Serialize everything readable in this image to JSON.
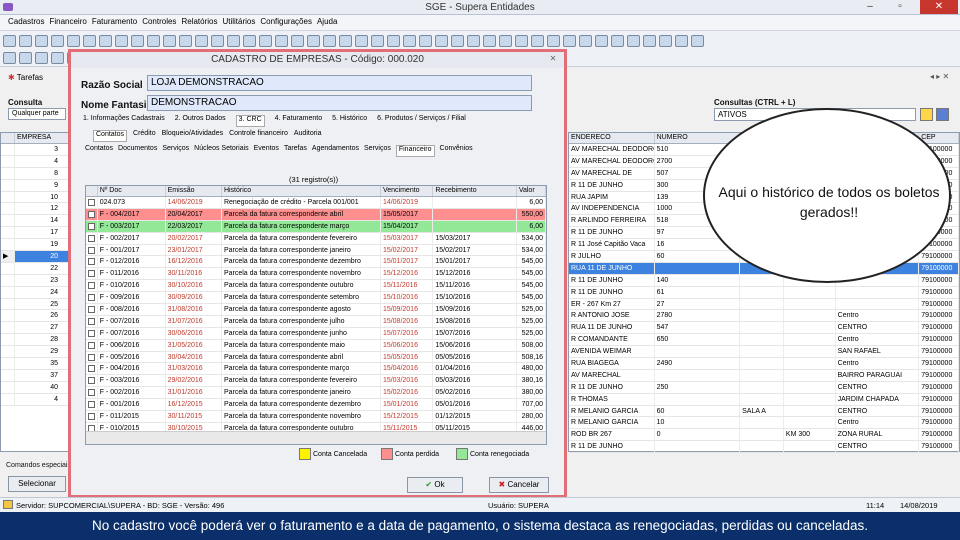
{
  "window": {
    "title": "SGE - Supera Entidades"
  },
  "menu": [
    "Cadastros",
    "Financeiro",
    "Faturamento",
    "Controles",
    "Relatórios",
    "Utilitários",
    "Configurações",
    "Ajuda"
  ],
  "tabs": {
    "tarefas": "Tarefas"
  },
  "left_panel": {
    "consulta_label": "Consulta",
    "consulta_value": "Qualquer parte",
    "col_empresa": "EMPRESA",
    "rows": [
      "3",
      "4",
      "8",
      "9",
      "10",
      "12",
      "14",
      "17",
      "19",
      "20",
      "22",
      "23",
      "24",
      "25",
      "26",
      "27",
      "28",
      "29",
      "35",
      "37",
      "40",
      "4"
    ],
    "bottom_label": "Comandos especiais",
    "bottom_btn": "Selecionar"
  },
  "right_panel": {
    "consultas_label": "Consultas (CTRL + L)",
    "consultas_value": "ATIVOS",
    "headers": [
      "ENDERECO",
      "NUMERO",
      "",
      "",
      "",
      "CEP"
    ],
    "rows": [
      [
        "AV MARECHAL DEODORO",
        "510",
        "",
        "",
        "",
        "79100000"
      ],
      [
        "AV MARECHAL DEODORO",
        "2700",
        "",
        "",
        "",
        "79100000"
      ],
      [
        "AV MARECHAL DE",
        "507",
        "",
        "",
        "",
        "79100000"
      ],
      [
        "R 11 DE JUNHO",
        "300",
        "",
        "",
        "",
        "79100000"
      ],
      [
        "RUA JAPIM",
        "139",
        "",
        "",
        "",
        "79100000"
      ],
      [
        "AV INDEPENDENCIA",
        "1000",
        "",
        "",
        "",
        "79100000"
      ],
      [
        "R ARLINDO FERREIRA",
        "518",
        "",
        "",
        "",
        "79100000"
      ],
      [
        "R 11 DE JUNHO",
        "97",
        "",
        "",
        "",
        "79100000"
      ],
      [
        "R 11 José Capitão Vaca",
        "16",
        "",
        "",
        "",
        "79100000"
      ],
      [
        "R JULHO",
        "60",
        "",
        "",
        "",
        "79100000"
      ],
      [
        "RUA 11 DE JUNHO",
        "",
        "",
        "",
        "",
        "79100000"
      ],
      [
        "R 11 DE JUNHO",
        "140",
        "",
        "",
        "",
        "79100000"
      ],
      [
        "R 11 DE JUNHO",
        "61",
        "",
        "",
        "",
        "79100000"
      ],
      [
        "ER - 267 Km 27",
        "27",
        "",
        "",
        "",
        "79100000"
      ],
      [
        "R ANTONIO JOSE",
        "2780",
        "",
        "",
        "Centro",
        "79100000"
      ],
      [
        "RUA 11 DE JUNHO",
        "547",
        "",
        "",
        "CENTRO",
        "79100000"
      ],
      [
        "R COMANDANTE",
        "650",
        "",
        "",
        "Centro",
        "79100000"
      ],
      [
        "AVENIDA WEIMAR",
        "",
        "",
        "",
        "SAN RAFAEL",
        "79100000"
      ],
      [
        "RUA BIAGEGA",
        "2490",
        "",
        "",
        "Centro",
        "79100000"
      ],
      [
        "AV MARECHAL",
        "",
        "",
        "",
        "BAIRRO PARAGUAI",
        "79100000"
      ],
      [
        "R 11 DE JUNHO",
        "250",
        "",
        "",
        "CENTRO",
        "79100000"
      ],
      [
        "R THOMAS",
        "",
        "",
        "",
        "JARDIM CHAPADA",
        "79100000"
      ],
      [
        "R MELANIO GARCIA",
        "60",
        "SALA A",
        "",
        "CENTRO",
        "79100000"
      ],
      [
        "R MELANIO GARCIA",
        "10",
        "",
        "",
        "Centro",
        "79100000"
      ],
      [
        "ROD BR 267",
        "0",
        "",
        "KM 300",
        "ZONA RURAL",
        "79100000"
      ],
      [
        "R 11 DE JUNHO",
        "",
        "",
        "",
        "CENTRO",
        "79100000"
      ]
    ]
  },
  "dialog": {
    "title": "CADASTRO DE EMPRESAS - Código: 000.020",
    "razao_label": "Razão Social",
    "razao_value": "LOJA DEMONSTRACAO",
    "fantasia_label": "Nome Fantasia",
    "fantasia_value": "DEMONSTRACAO",
    "tabs1": [
      "1. Informações Cadastrais",
      "2. Outros Dados",
      "3. CRC",
      "4. Faturamento",
      "5. Histórico",
      "6. Produtos / Serviços / Filial"
    ],
    "tabs2": [
      "Contatos",
      "Crédito",
      "Bloqueio/Atividades",
      "Controle financeiro",
      "Auditoria"
    ],
    "tabs3": [
      "Contatos",
      "Documentos",
      "Serviços",
      "Núcleos Setoriais",
      "Eventos",
      "Tarefas",
      "Agendamentos",
      "Serviços",
      "Financeiro",
      "Convênios"
    ],
    "count_label": "(31 registro(s))",
    "table": {
      "headers": [
        "Nº Doc",
        "Emissão",
        "Histórico",
        "Vencimento",
        "Recebimento",
        "Valor"
      ],
      "rows": [
        {
          "doc": "024.073",
          "emissao": "14/06/2019",
          "hist": "Renegociação de crédito - Parcela 001/001",
          "venc": "14/06/2019",
          "receb": "",
          "valor": "6,00",
          "status": "none"
        },
        {
          "doc": "F - 004/2017",
          "emissao": "20/04/2017",
          "hist": "Parcela da fatura correspondente abril",
          "venc": "15/05/2017",
          "receb": "",
          "valor": "550,00",
          "status": "lost"
        },
        {
          "doc": "F - 003/2017",
          "emissao": "22/03/2017",
          "hist": "Parcela da fatura correspondente março",
          "venc": "15/04/2017",
          "receb": "",
          "valor": "6,00",
          "status": "renegotiated"
        },
        {
          "doc": "F - 002/2017",
          "emissao": "20/02/2017",
          "hist": "Parcela da fatura correspondente fevereiro",
          "venc": "15/03/2017",
          "receb": "15/03/2017",
          "valor": "534,00",
          "status": "none"
        },
        {
          "doc": "F - 001/2017",
          "emissao": "23/01/2017",
          "hist": "Parcela da fatura correspondente janeiro",
          "venc": "15/02/2017",
          "receb": "15/02/2017",
          "valor": "534,00",
          "status": "none"
        },
        {
          "doc": "F - 012/2016",
          "emissao": "16/12/2016",
          "hist": "Parcela da fatura correspondente dezembro",
          "venc": "15/01/2017",
          "receb": "15/01/2017",
          "valor": "545,00",
          "status": "none"
        },
        {
          "doc": "F - 011/2016",
          "emissao": "30/11/2016",
          "hist": "Parcela da fatura correspondente novembro",
          "venc": "15/12/2016",
          "receb": "15/12/2016",
          "valor": "545,00",
          "status": "none"
        },
        {
          "doc": "F - 010/2016",
          "emissao": "30/10/2016",
          "hist": "Parcela da fatura correspondente outubro",
          "venc": "15/11/2016",
          "receb": "15/11/2016",
          "valor": "545,00",
          "status": "none"
        },
        {
          "doc": "F - 009/2016",
          "emissao": "30/09/2016",
          "hist": "Parcela da fatura correspondente setembro",
          "venc": "15/10/2016",
          "receb": "15/10/2016",
          "valor": "545,00",
          "status": "none"
        },
        {
          "doc": "F - 008/2016",
          "emissao": "31/08/2016",
          "hist": "Parcela da fatura correspondente agosto",
          "venc": "15/09/2016",
          "receb": "15/09/2016",
          "valor": "525,00",
          "status": "none"
        },
        {
          "doc": "F - 007/2016",
          "emissao": "31/07/2016",
          "hist": "Parcela da fatura correspondente julho",
          "venc": "15/08/2016",
          "receb": "15/08/2016",
          "valor": "525,00",
          "status": "none"
        },
        {
          "doc": "F - 007/2016",
          "emissao": "30/06/2016",
          "hist": "Parcela da fatura correspondente junho",
          "venc": "15/07/2016",
          "receb": "15/07/2016",
          "valor": "525,00",
          "status": "none"
        },
        {
          "doc": "F - 006/2016",
          "emissao": "31/05/2016",
          "hist": "Parcela da fatura correspondente maio",
          "venc": "15/06/2016",
          "receb": "15/06/2016",
          "valor": "508,00",
          "status": "none"
        },
        {
          "doc": "F - 005/2016",
          "emissao": "30/04/2016",
          "hist": "Parcela da fatura correspondente abril",
          "venc": "15/05/2016",
          "receb": "05/05/2016",
          "valor": "508,16",
          "status": "none"
        },
        {
          "doc": "F - 004/2016",
          "emissao": "31/03/2016",
          "hist": "Parcela da fatura correspondente março",
          "venc": "15/04/2016",
          "receb": "01/04/2016",
          "valor": "480,00",
          "status": "none"
        },
        {
          "doc": "F - 003/2016",
          "emissao": "29/02/2016",
          "hist": "Parcela da fatura correspondente fevereiro",
          "venc": "15/03/2016",
          "receb": "05/03/2016",
          "valor": "380,16",
          "status": "none"
        },
        {
          "doc": "F - 002/2016",
          "emissao": "31/01/2016",
          "hist": "Parcela da fatura correspondente janeiro",
          "venc": "15/02/2016",
          "receb": "05/02/2016",
          "valor": "380,00",
          "status": "none"
        },
        {
          "doc": "F - 001/2016",
          "emissao": "16/12/2015",
          "hist": "Parcela da fatura correspondente dezembro",
          "venc": "15/01/2016",
          "receb": "05/01/2016",
          "valor": "707,00",
          "status": "none"
        },
        {
          "doc": "F - 011/2015",
          "emissao": "30/11/2015",
          "hist": "Parcela da fatura correspondente novembro",
          "venc": "15/12/2015",
          "receb": "01/12/2015",
          "valor": "280,00",
          "status": "none"
        },
        {
          "doc": "F - 010/2015",
          "emissao": "30/10/2015",
          "hist": "Parcela da fatura correspondente outubro",
          "venc": "15/11/2015",
          "receb": "05/11/2015",
          "valor": "446,00",
          "status": "none"
        }
      ]
    },
    "legend": {
      "cancelled": "Conta Cancelada",
      "lost": "Conta perdida",
      "renegotiated": "Conta renegociada"
    },
    "ok": "Ok",
    "cancel": "Cancelar"
  },
  "statusbar": {
    "server": "Servidor: SUPCOMERCIAL\\SUPERA - BD: SGE - Versão: 496",
    "user": "Usuário: SUPERA",
    "time": "11:14",
    "date": "14/08/2019"
  },
  "callout": {
    "text": "Aqui o histórico de todos os boletos gerados!!"
  },
  "caption": {
    "text": "No cadastro você poderá ver o faturamento e a data de pagamento, o sistema destaca as renegociadas, perdidas ou canceladas."
  },
  "colors": {
    "lost": "#ff8f8f",
    "renegotiated": "#93e897",
    "cancelled": "#fff200",
    "selection": "#3c82de",
    "caption_bg": "#0a2f6a",
    "dialog_border": "#e26f77"
  }
}
